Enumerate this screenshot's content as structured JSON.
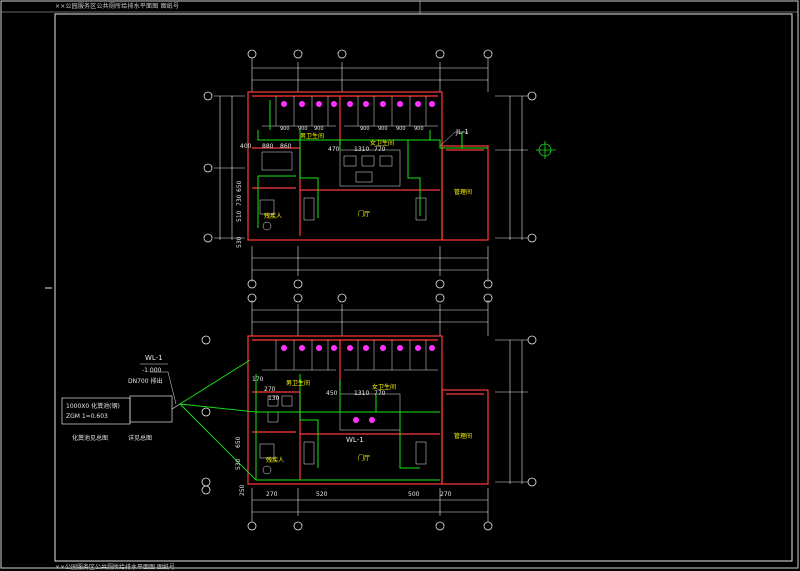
{
  "title_block": {
    "top_text": "××公园服务区公共厕所给排水平面图 图纸号",
    "bottom_text": "××公园服务区公共厕所给排水平面图 图纸号"
  },
  "colors": {
    "background": "#000000",
    "wall": "#ff3b3b",
    "pipe_green": "#19e619",
    "dim_white": "#e6e6e6",
    "label_yellow": "#ffff00",
    "fixture_magenta": "#ff33ff",
    "axis_cyan": "#22d3d3"
  },
  "plan_top": {
    "room_male": "男卫生间",
    "room_female": "女卫生间",
    "room_hall": "门厅",
    "room_manage": "管理间",
    "room_disabled": "残疾人",
    "pipe_tag": "JL-1",
    "dims": [
      "400",
      "880",
      "860",
      "470",
      "1310",
      "770",
      "400",
      "510",
      "730",
      "650",
      "530"
    ]
  },
  "plan_bottom": {
    "room_male": "男卫生间",
    "room_female": "女卫生间",
    "room_hall": "门厅",
    "room_manage": "管理间",
    "room_disabled": "残疾人",
    "pipe_tag": "WL-1",
    "dims_top": [
      "270",
      "170",
      "130",
      "450",
      "1310",
      "770"
    ],
    "dims_bottom": [
      "270",
      "520",
      "500",
      "270"
    ],
    "dims_left": [
      "250",
      "650",
      "530"
    ]
  },
  "callout": {
    "tag": "WL-1",
    "level": "-1.000",
    "note": "DN700 排出",
    "box_line1": "1000X0 化粪池(钢)",
    "box_line2": "ZGM 1=0.603",
    "label_left": "化粪池见总图",
    "label_right": "详见总图"
  },
  "axis_marks": [
    "1",
    "2",
    "3",
    "4",
    "5",
    "A",
    "B",
    "C",
    "D"
  ]
}
